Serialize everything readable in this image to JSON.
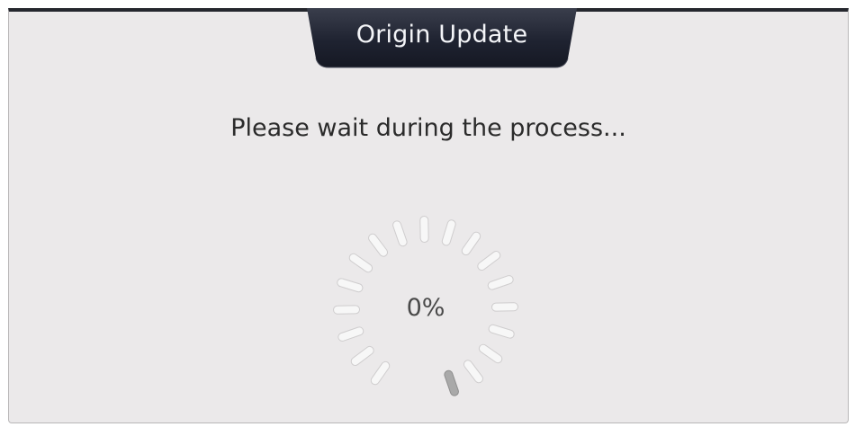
{
  "dialog": {
    "title": "Origin Update",
    "message": "Please wait during the process..."
  },
  "progress": {
    "label": "0%",
    "value_percent": 0
  },
  "colors": {
    "title_tab": "#1e2230",
    "dialog_background": "#ebe9ea",
    "spinner_segment": "#f7f7f7",
    "spinner_segment_active": "#a9a9a9"
  },
  "icons": {
    "spinner": "circular-progress-spinner-icon"
  }
}
